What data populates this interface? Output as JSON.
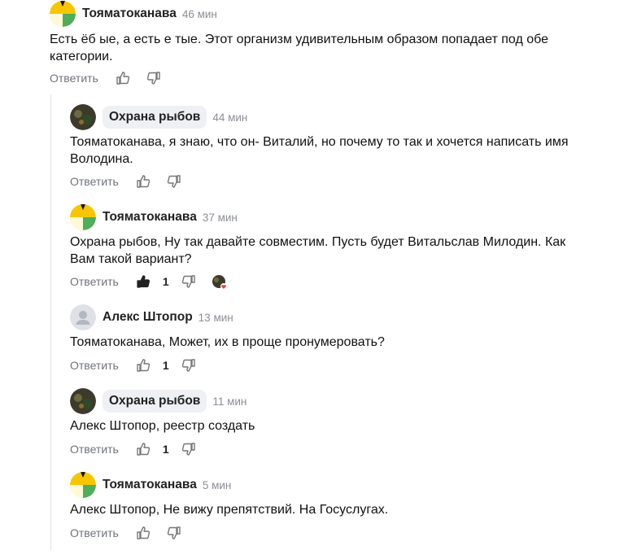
{
  "comments": [
    {
      "author": "Тояматоканава",
      "time": "46 мин",
      "text": "Есть ёб      ые, а есть е       тые. Этот организм удивительным образом попадает под обе категории.",
      "reply": "Ответить"
    },
    {
      "author": "Охрана рыбов",
      "time": "44 мин",
      "text": "Тояматоканава, я знаю, что он- Виталий, но почему то так и хочется написать имя Володина.",
      "reply": "Ответить"
    },
    {
      "author": "Тояматоканава",
      "time": "37 мин",
      "text": "Охрана рыбов, Ну так давайте совместим. Пусть будет Витальслав Милодин. Как Вам такой вариант?",
      "reply": "Ответить",
      "likes": "1"
    },
    {
      "author": "Алекс Штопор",
      "time": "13 мин",
      "text": "Тояматоканава, Может, их в     проще пронумеровать?",
      "reply": "Ответить",
      "likes": "1"
    },
    {
      "author": "Охрана рыбов",
      "time": "11 мин",
      "text": "Алекс Штопор, реестр создать",
      "reply": "Ответить",
      "likes": "1"
    },
    {
      "author": "Тояматоканава",
      "time": "5 мин",
      "text": "Алекс Штопор, Не вижу препятствий. На Госуслугах.",
      "reply": "Ответить"
    }
  ],
  "colors": {
    "yellow": "#f7c600",
    "green": "#4fae5a",
    "muted": "#8b8f96"
  }
}
